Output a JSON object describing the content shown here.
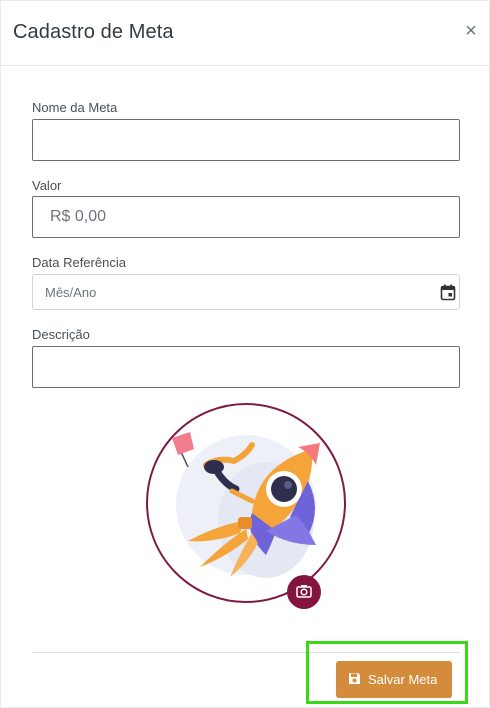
{
  "modal": {
    "title": "Cadastro de Meta",
    "close_symbol": "×"
  },
  "form": {
    "nome": {
      "label": "Nome da Meta",
      "value": ""
    },
    "valor": {
      "label": "Valor",
      "placeholder": "R$ 0,00",
      "value": ""
    },
    "data": {
      "label": "Data Referência",
      "placeholder": "Mês/Ano",
      "icon": "calendar-icon"
    },
    "descricao": {
      "label": "Descrição",
      "value": ""
    }
  },
  "image": {
    "description_icon": "rocket-illustration",
    "camera_icon": "camera-icon",
    "ring_color": "#7d1b45"
  },
  "footer": {
    "save_label": "Salvar Meta",
    "save_icon": "floppy-disk-icon",
    "button_color": "#d28c3c",
    "highlight_color": "#39d918"
  }
}
